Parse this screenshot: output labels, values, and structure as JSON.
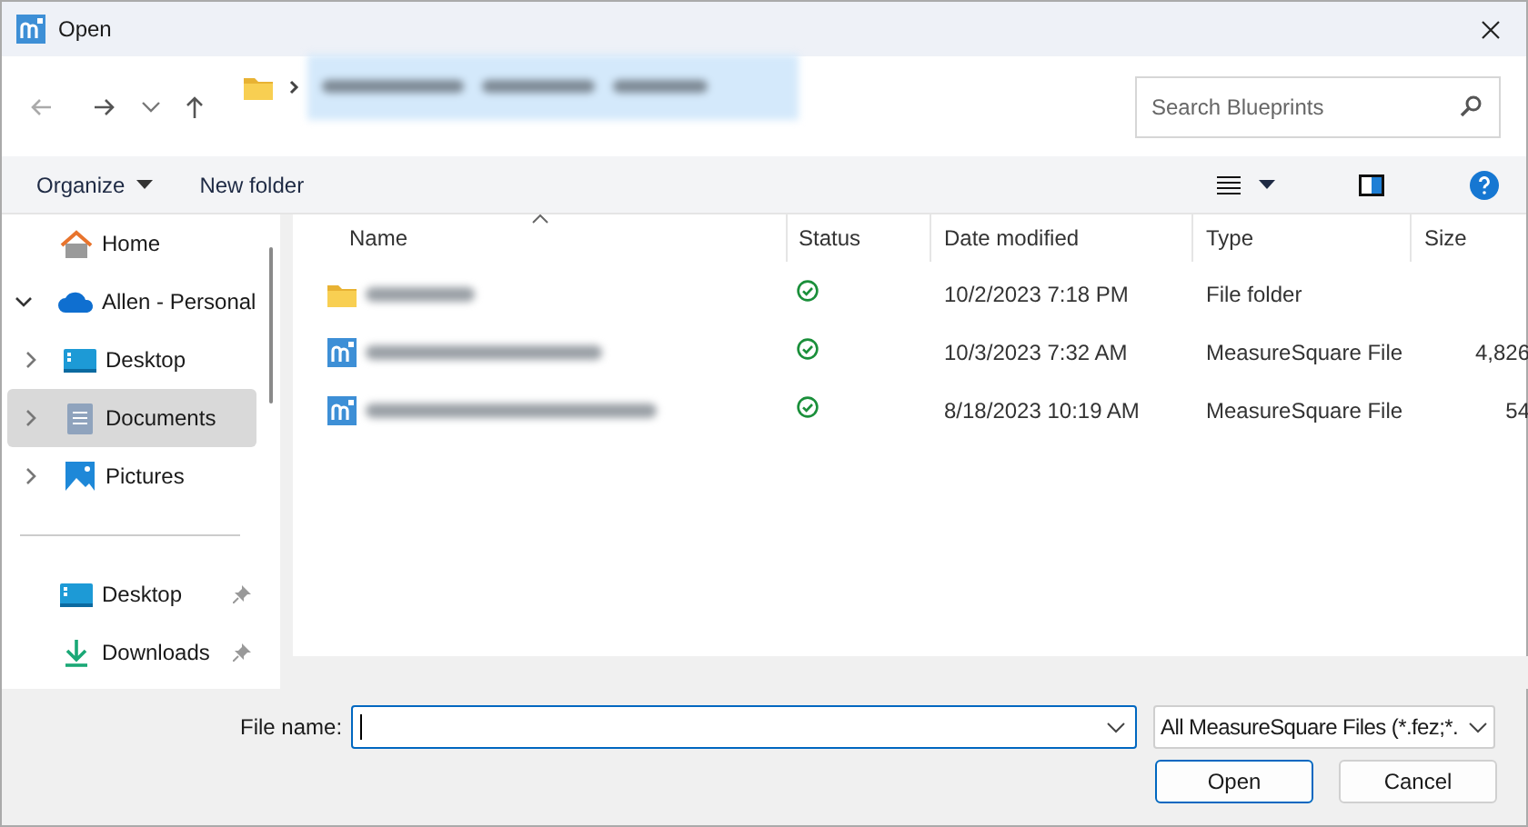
{
  "window": {
    "title": "Open"
  },
  "search": {
    "placeholder": "Search Blueprints"
  },
  "toolbar": [
    {
      "label": "Organize",
      "dropdown": true
    },
    {
      "label": "New folder",
      "dropdown": false
    }
  ],
  "sidebar": {
    "items": [
      {
        "label": "Home",
        "kind": "home",
        "selected": false
      },
      {
        "label": "Allen - Personal",
        "kind": "cloud",
        "expanded": true,
        "selected": false,
        "children": [
          {
            "label": "Desktop",
            "kind": "desktop",
            "expanded": false,
            "selected": false
          },
          {
            "label": "Documents",
            "kind": "documents",
            "expanded": false,
            "selected": true
          },
          {
            "label": "Pictures",
            "kind": "pictures",
            "expanded": false,
            "selected": false
          }
        ]
      },
      {
        "kind": "divider"
      },
      {
        "label": "Desktop",
        "kind": "desktop",
        "pinned": true,
        "selected": false
      },
      {
        "label": "Downloads",
        "kind": "downloads",
        "pinned": true,
        "selected": false
      }
    ]
  },
  "table": {
    "columns": [
      {
        "label": "Name",
        "sorted": true
      },
      {
        "label": "Status",
        "sorted": false
      },
      {
        "label": "Date modified",
        "sorted": false
      },
      {
        "label": "Type",
        "sorted": false
      },
      {
        "label": "Size",
        "sorted": false
      }
    ],
    "rows": [
      {
        "kind": "folder",
        "date": "10/2/2023 7:18 PM",
        "type": "File folder"
      },
      {
        "kind": "file",
        "date": "10/3/2023 7:32 AM",
        "type": "MeasureSquare File",
        "size": "4,826"
      },
      {
        "kind": "file",
        "date": "8/18/2023 10:19 AM",
        "type": "MeasureSquare File",
        "size": "54"
      }
    ]
  },
  "file_name": {
    "label": "File name:"
  },
  "filter": {
    "value": "All MeasureSquare Files (*.fez;*."
  },
  "buttons": [
    {
      "label": "Open",
      "default": true
    },
    {
      "label": "Cancel",
      "default": false
    }
  ]
}
